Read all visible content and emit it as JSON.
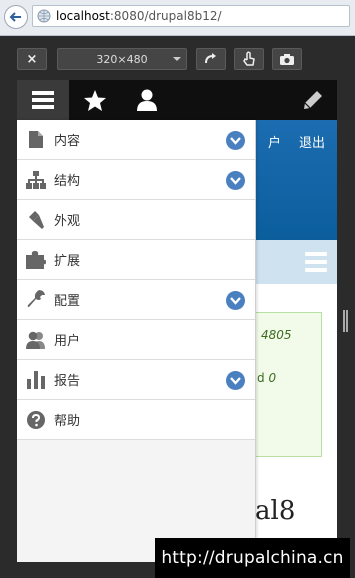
{
  "browser": {
    "address_host": "localhost",
    "address_rest": ":8080/drupal8b12/"
  },
  "responsive_toolbar": {
    "close_label": "×",
    "size_value": "320×480"
  },
  "toolbar": {
    "tabs": [
      {
        "name": "menu",
        "icon": "hamburger-icon"
      },
      {
        "name": "shortcuts",
        "icon": "star-icon"
      },
      {
        "name": "user",
        "icon": "user-icon"
      }
    ],
    "edit_icon": "pencil-icon"
  },
  "menu": {
    "items": [
      {
        "label": "内容",
        "icon": "document-icon",
        "expandable": true
      },
      {
        "label": "结构",
        "icon": "sitemap-icon",
        "expandable": true
      },
      {
        "label": "外观",
        "icon": "brush-icon",
        "expandable": false
      },
      {
        "label": "扩展",
        "icon": "puzzle-icon",
        "expandable": false
      },
      {
        "label": "配置",
        "icon": "wrench-icon",
        "expandable": true
      },
      {
        "label": "用户",
        "icon": "people-icon",
        "expandable": false
      },
      {
        "label": "报告",
        "icon": "bar-chart-icon",
        "expandable": true
      },
      {
        "label": "帮助",
        "icon": "help-icon",
        "expandable": false
      }
    ]
  },
  "page": {
    "link_partial": "户",
    "logout": "退出",
    "message_line1": "4805",
    "message_line2_prefix": "d ",
    "message_line2_italic": "0",
    "heading_fragment": "al8"
  },
  "watermark": "http://drupalchina.cn",
  "colors": {
    "toolbar_bg": "#0f0f0f",
    "active_tab_bg": "#3a3a3a",
    "expand_button": "#4a80c0",
    "header_blue": "#1c6cb1"
  }
}
